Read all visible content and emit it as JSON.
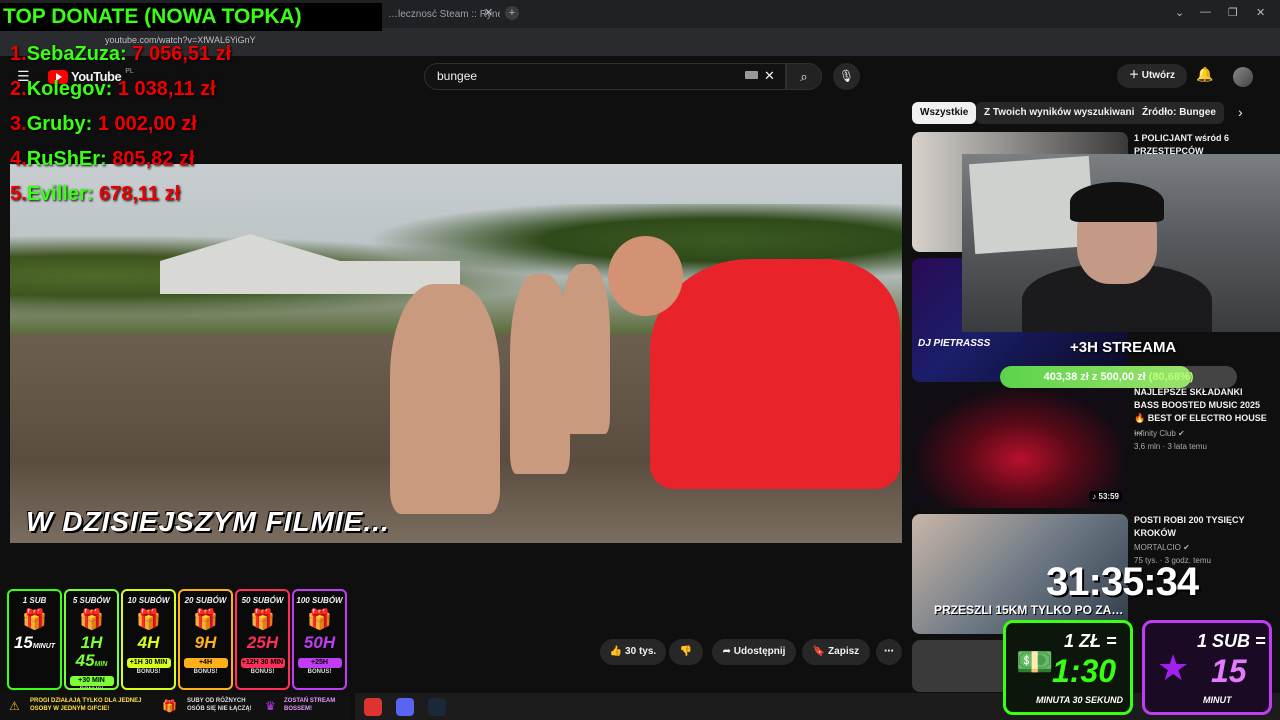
{
  "browser": {
    "tabs": [
      "…lecznosć Steam :: Rynek Sp…"
    ],
    "url": "youtube.com/watch?v=XfWAL6YiGnY"
  },
  "youtube": {
    "logo": "YouTube",
    "region": "PL",
    "search_value": "bungee",
    "create_label": "Utwórz",
    "chips": [
      "Wszystkie",
      "Z Twoich wyników wyszukiwania",
      "Źródło: Bungee"
    ],
    "video_caption": "W DZISIEJSZYM FILMIE...",
    "actions": {
      "likes": "30 tys.",
      "share": "Udostępnij",
      "save": "Zapisz"
    },
    "recommendations": [
      {
        "title": "1 POLICJANT wśród 6 PRZESTĘPCÓW"
      },
      {
        "title": "NAJLEPSZE SKŁADANKI BASS BOOSTED MUSIC 2025 🔥 BEST OF ELECTRO HOUSE ...",
        "channel": "Infinity Club",
        "meta": "3,6 mln · 3 lata temu",
        "duration": "53:59",
        "thumb_text": "DJ PIETRASSS"
      },
      {
        "title": "POSTI ROBI 200 TYSIĘCY KROKÓW",
        "channel": "MORTALCIO",
        "meta": "75 tys. · 3 godz. temu",
        "thumb_text": "PRZESZLI 15KM TYLKO PO ZA…"
      }
    ]
  },
  "overlay": {
    "donate_title": "TOP DONATE (NOWA TOPKA)",
    "donors": [
      {
        "rank": "1.",
        "name": "SebaZuza",
        "amount": "7 056,51 zł"
      },
      {
        "rank": "2.",
        "name": "Kolegov",
        "amount": "1 038,11 zł"
      },
      {
        "rank": "3.",
        "name": "Gruby",
        "amount": "1 002,00 zł"
      },
      {
        "rank": "4.",
        "name": "RuShEr",
        "amount": "805,82 zł"
      },
      {
        "rank": "5.",
        "name": "Eviller",
        "amount": "678,11 zł"
      }
    ],
    "stream_goal": "+3H STREAMA",
    "progress_text": "403,38 zł z 500,00 zł",
    "progress_pct": "(80,68%)",
    "progress_value": 0.8068,
    "timer": "31:35:34",
    "sub_cards": [
      {
        "label": "1 SUB",
        "value": "15",
        "unit": "MINUT",
        "bonus": "",
        "color": "#39ff14"
      },
      {
        "label": "5 SUBÓW",
        "value": "1H 45",
        "unit": "MIN",
        "bonus": "+30 MIN",
        "color": "#7cff3a"
      },
      {
        "label": "10 SUBÓW",
        "value": "4H",
        "unit": "",
        "bonus": "+1H 30 MIN",
        "color": "#d6ff1a"
      },
      {
        "label": "20 SUBÓW",
        "value": "9H",
        "unit": "",
        "bonus": "+4H",
        "color": "#ffb11a"
      },
      {
        "label": "50 SUBÓW",
        "value": "25H",
        "unit": "",
        "bonus": "+12H 30 MIN",
        "color": "#ff2f5a"
      },
      {
        "label": "100 SUBÓW",
        "value": "50H",
        "unit": "",
        "bonus": "+25H",
        "color": "#c03cf5"
      }
    ],
    "bonus_label": "BONUS!",
    "info": [
      "PROGI DZIAŁAJĄ TYLKO DLA JEDNEJ OSOBY W JEDNYM GIFCIE!",
      "SUBY OD RÓŻNYCH OSÓB SIĘ NIE ŁĄCZĄ!",
      "ZOSTAŃ STREAM BOSSEM!"
    ],
    "promo_money": {
      "head": "1 ZŁ =",
      "big": "1:30",
      "sub": "MINUTA 30 SEKUND"
    },
    "promo_sub": {
      "head": "1 SUB =",
      "big": "15",
      "sub": "MINUT"
    }
  }
}
